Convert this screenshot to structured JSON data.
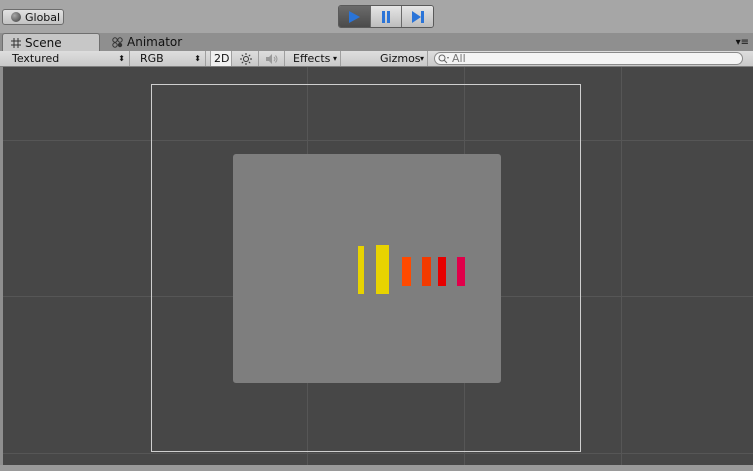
{
  "topbar": {
    "global_label": "Global",
    "play_icon": "play-icon",
    "pause_icon": "pause-icon",
    "step_icon": "step-icon"
  },
  "tabs": [
    {
      "label": "Scene",
      "icon": "grid-icon"
    },
    {
      "label": "Animator",
      "icon": "animator-icon"
    }
  ],
  "toolbar": {
    "draw_mode": "Textured",
    "render_mode": "RGB",
    "toggle_2d": "2D",
    "lighting_icon": "sun-icon",
    "audio_icon": "speaker-icon",
    "effects": "Effects",
    "gizmos": "Gizmos",
    "search_placeholder": "All"
  },
  "colors": {
    "accent_blue": "#2a74d8",
    "yellow": "#e8d300",
    "orange": "#ff4a00",
    "red": "#e60000",
    "pink": "#e0004a"
  }
}
